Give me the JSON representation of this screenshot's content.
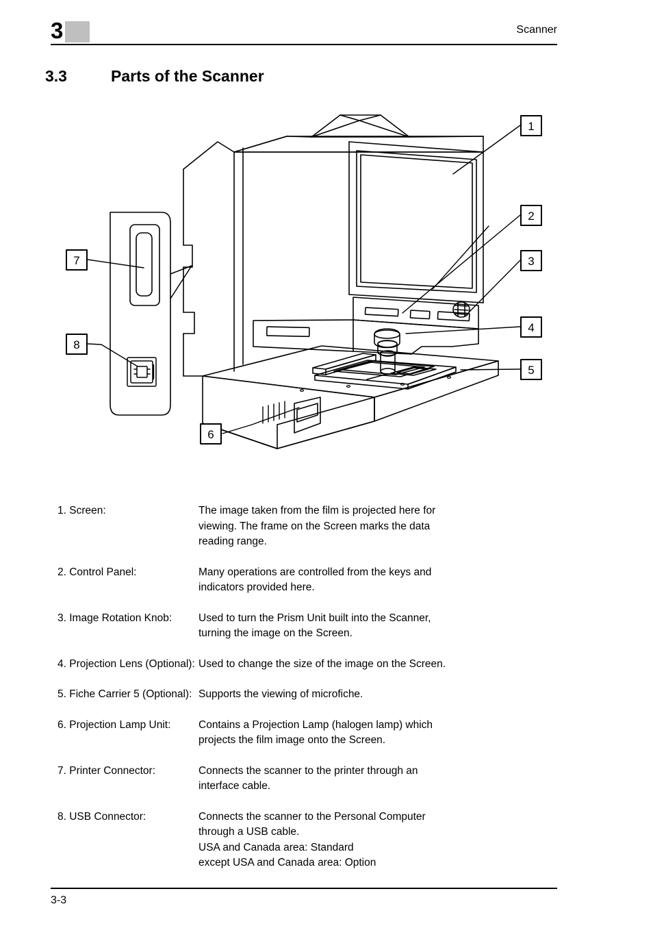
{
  "header": {
    "chapter_number": "3",
    "title": "Scanner",
    "badge_color": "#bfbfbf"
  },
  "section": {
    "number": "3.3",
    "title": "Parts of the Scanner"
  },
  "figure": {
    "name": "scanner-parts-diagram",
    "callouts": [
      {
        "id": "1",
        "label": "1"
      },
      {
        "id": "2",
        "label": "2"
      },
      {
        "id": "3",
        "label": "3"
      },
      {
        "id": "4",
        "label": "4"
      },
      {
        "id": "5",
        "label": "5"
      },
      {
        "id": "6",
        "label": "6"
      },
      {
        "id": "7",
        "label": "7"
      },
      {
        "id": "8",
        "label": "8"
      }
    ]
  },
  "parts": [
    {
      "number": "1",
      "label": "1. Screen:",
      "description_lines": [
        "The image taken from the film is projected here for",
        "viewing. The frame on the Screen marks the data",
        "reading range."
      ]
    },
    {
      "number": "2",
      "label": "2. Control Panel:",
      "description_lines": [
        "Many operations are controlled from the keys and",
        "indicators provided here."
      ]
    },
    {
      "number": "3",
      "label": "3. Image Rotation Knob:",
      "description_lines": [
        "Used to turn the Prism Unit built into the Scanner,",
        "turning the image on the Screen."
      ]
    },
    {
      "number": "4",
      "label": "4. Projection Lens (Optional):",
      "description_lines": [
        "Used to change the size of the image on the Screen."
      ]
    },
    {
      "number": "5",
      "label": "5. Fiche Carrier 5 (Optional):",
      "description_lines": [
        "Supports the viewing of microfiche."
      ]
    },
    {
      "number": "6",
      "label": "6. Projection Lamp Unit:",
      "description_lines": [
        "Contains a Projection Lamp (halogen lamp) which",
        "projects the film image onto the Screen."
      ]
    },
    {
      "number": "7",
      "label": "7. Printer Connector:",
      "description_lines": [
        "Connects the scanner to the printer through an",
        "interface cable."
      ]
    },
    {
      "number": "8",
      "label": "8. USB Connector:",
      "description_lines": [
        "Connects the scanner to the Personal Computer",
        "through a USB cable.",
        "USA and Canada area: Standard",
        "except USA and Canada area: Option"
      ]
    }
  ],
  "footer": {
    "page_number": "3-3"
  }
}
